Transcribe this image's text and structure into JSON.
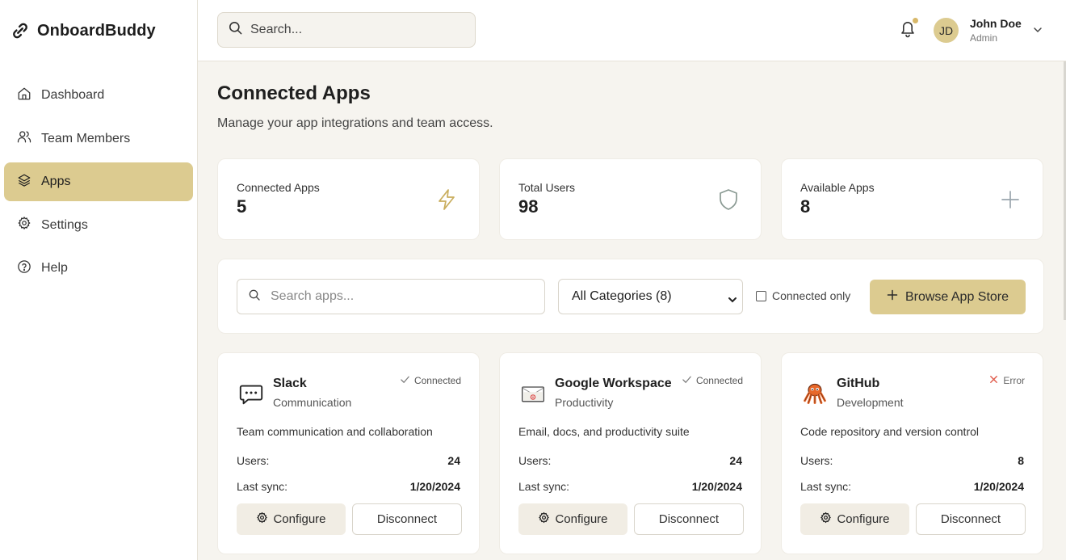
{
  "brand": {
    "name": "OnboardBuddy",
    "icon": "link-icon"
  },
  "nav": {
    "items": [
      {
        "label": "Dashboard",
        "icon": "home-icon",
        "active": false
      },
      {
        "label": "Team Members",
        "icon": "users-icon",
        "active": false
      },
      {
        "label": "Apps",
        "icon": "layers-icon",
        "active": true
      },
      {
        "label": "Settings",
        "icon": "gear-icon",
        "active": false
      },
      {
        "label": "Help",
        "icon": "help-circle-icon",
        "active": false
      }
    ]
  },
  "header": {
    "search_placeholder": "Search...",
    "user": {
      "initials": "JD",
      "name": "John Doe",
      "role": "Admin"
    }
  },
  "page": {
    "title": "Connected Apps",
    "subtitle": "Manage your app integrations and team access."
  },
  "stats": [
    {
      "label": "Connected Apps",
      "value": "5",
      "icon": "lightning-icon"
    },
    {
      "label": "Total Users",
      "value": "98",
      "icon": "shield-icon"
    },
    {
      "label": "Available Apps",
      "value": "8",
      "icon": "plus-icon"
    }
  ],
  "filters": {
    "search_placeholder": "Search apps...",
    "category_selected": "All Categories (8)",
    "connected_only_label": "Connected only",
    "browse_label": "Browse App Store"
  },
  "apps": [
    {
      "name": "Slack",
      "category": "Communication",
      "status": "Connected",
      "description": "Team communication and collaboration",
      "users_label": "Users:",
      "users": "24",
      "sync_label": "Last sync:",
      "last_sync": "1/20/2024",
      "configure_label": "Configure",
      "disconnect_label": "Disconnect"
    },
    {
      "name": "Google Workspace",
      "category": "Productivity",
      "status": "Connected",
      "description": "Email, docs, and productivity suite",
      "users_label": "Users:",
      "users": "24",
      "sync_label": "Last sync:",
      "last_sync": "1/20/2024",
      "configure_label": "Configure",
      "disconnect_label": "Disconnect"
    },
    {
      "name": "GitHub",
      "category": "Development",
      "status": "Error",
      "description": "Code repository and version control",
      "users_label": "Users:",
      "users": "8",
      "sync_label": "Last sync:",
      "last_sync": "1/20/2024",
      "configure_label": "Configure",
      "disconnect_label": "Disconnect"
    }
  ],
  "colors": {
    "accent": "#dccb90",
    "background": "#f6f4ef",
    "error": "#e05a4a"
  }
}
